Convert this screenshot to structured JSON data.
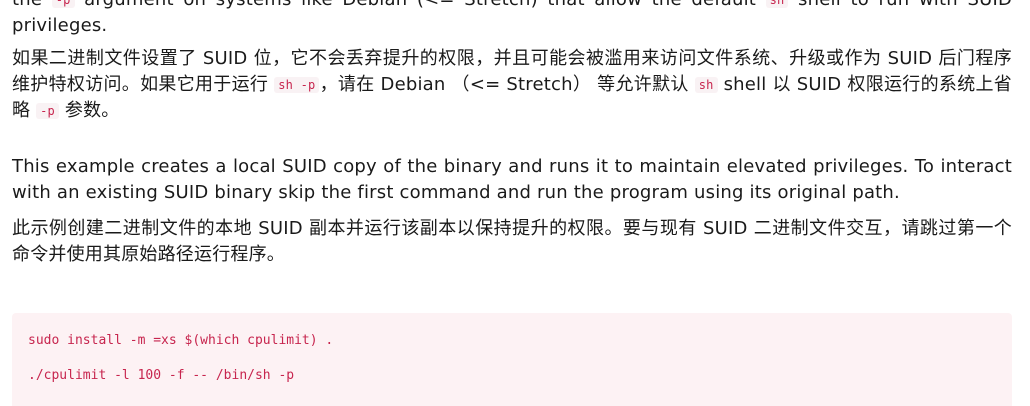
{
  "paragraphs": {
    "p0": {
      "t0": "the ",
      "c0": "-p",
      "t1": " argument on systems like Debian (<= Stretch) that allow the default ",
      "c1": "sh",
      "t2": " shell to run with SUID privileges."
    },
    "p1": {
      "t0": "如果二进制文件设置了 SUID 位，它不会丢弃提升的权限，并且可能会被滥用来访问文件系统、升级或作为 SUID 后门程序维护特权访问。如果它用于运行 ",
      "c0": "sh -p",
      "t1": "，请在 Debian （<= Stretch） 等允许默认 ",
      "c1": "sh",
      "t2": " shell 以 SUID 权限运行的系统上省略 ",
      "c2": "-p",
      "t3": " 参数。"
    },
    "p2": "This example creates a local SUID copy of the binary and runs it to maintain elevated privileges. To interact with an existing SUID binary skip the first command and run the program using its original path.",
    "p3": "此示例创建二进制文件的本地 SUID 副本并运行该副本以保持提升的权限。要与现有 SUID 二进制文件交互，请跳过第一个命令并使用其原始路径运行程序。"
  },
  "code_block": {
    "lines": [
      "sudo install -m =xs $(which cpulimit) .",
      "./cpulimit -l 100 -f -- /bin/sh -p"
    ]
  }
}
